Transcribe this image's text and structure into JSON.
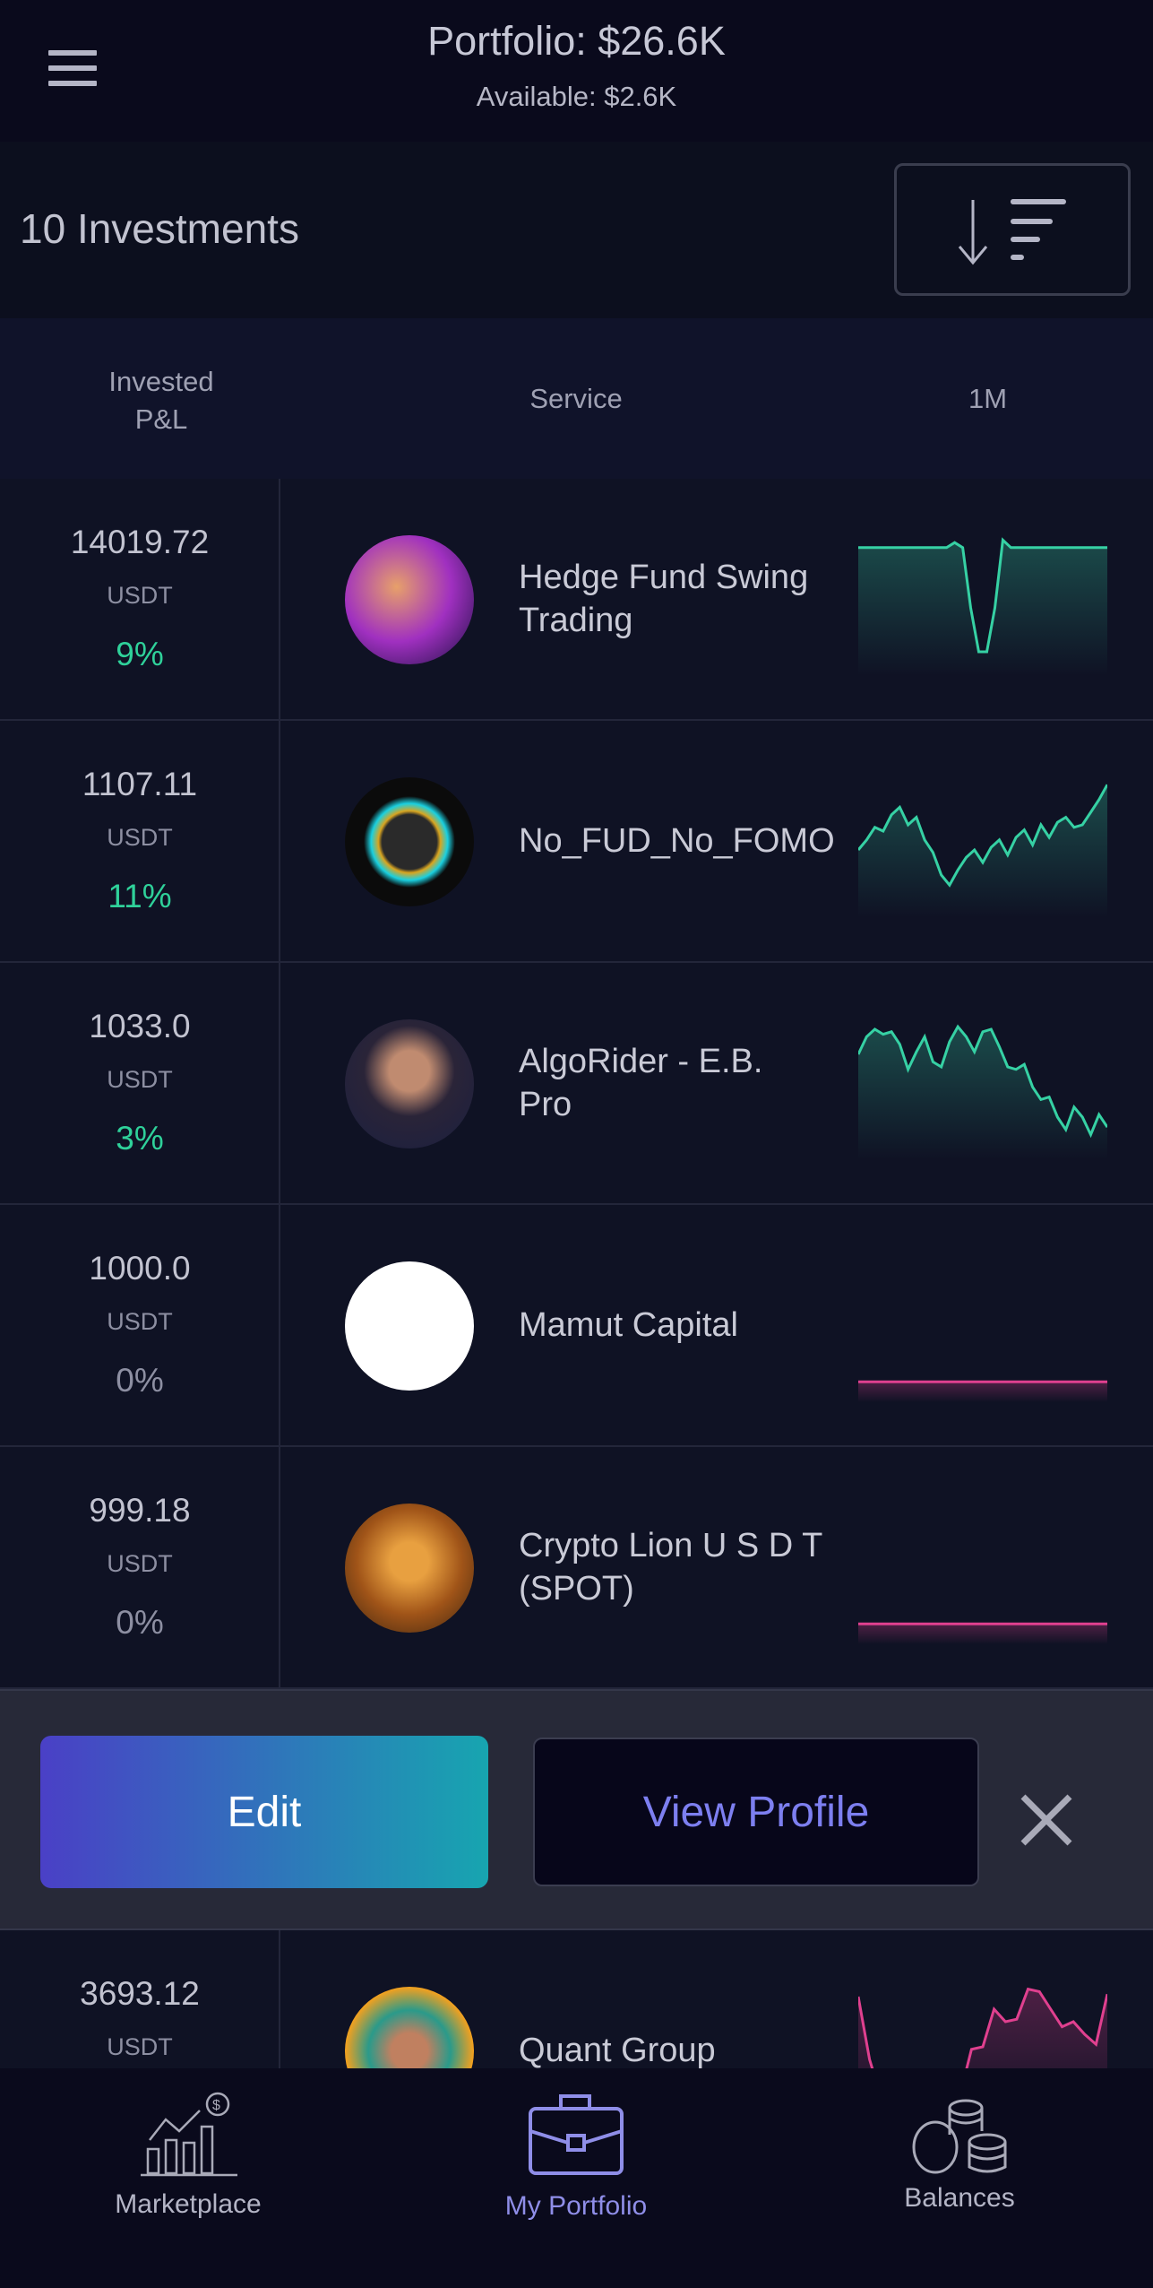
{
  "header": {
    "title": "Portfolio: $26.6K",
    "available": "Available: $2.6K",
    "menu_icon": "hamburger-menu-icon"
  },
  "toolbar": {
    "count_label": "10 Investments",
    "sort_icon": "sort-descending-icon"
  },
  "columns": {
    "invested_line1": "Invested",
    "invested_line2": "P&L",
    "service": "Service",
    "period": "1M"
  },
  "colors": {
    "positive": "#2fd19a",
    "neutral": "#8d8fa2",
    "spark_up": "#36d1a4",
    "spark_flat": "#e0408f",
    "accent": "#7d7ff0"
  },
  "rows": [
    {
      "amount": "14019.72",
      "unit": "USDT",
      "pnl": "9%",
      "pnl_color": "#2fd19a",
      "name": "Hedge Fund Swing Trading",
      "spark": [
        88,
        88,
        88,
        88,
        88,
        88,
        88,
        88,
        88,
        88,
        88,
        88,
        92,
        88,
        40,
        5,
        5,
        40,
        94,
        88,
        88,
        88,
        88,
        88,
        88,
        88,
        88,
        88,
        88,
        88,
        88,
        88
      ],
      "spark_color": "#36d1a4"
    },
    {
      "amount": "1107.11",
      "unit": "USDT",
      "pnl": "11%",
      "pnl_color": "#2fd19a",
      "name": "No_FUD_No_FOMO",
      "spark": [
        40,
        48,
        58,
        55,
        68,
        74,
        60,
        66,
        48,
        38,
        20,
        12,
        24,
        34,
        40,
        30,
        42,
        48,
        36,
        50,
        56,
        44,
        60,
        50,
        62,
        66,
        58,
        60,
        70,
        80,
        92
      ],
      "spark_color": "#36d1a4"
    },
    {
      "amount": "1033.0",
      "unit": "USDT",
      "pnl": "3%",
      "pnl_color": "#2fd19a",
      "name": "AlgoRider - E.B. Pro",
      "spark": [
        70,
        84,
        90,
        86,
        88,
        78,
        58,
        72,
        84,
        64,
        60,
        80,
        92,
        84,
        72,
        88,
        90,
        76,
        60,
        58,
        62,
        44,
        34,
        36,
        20,
        10,
        28,
        20,
        6,
        22,
        12
      ],
      "spark_color": "#36d1a4"
    },
    {
      "amount": "1000.0",
      "unit": "USDT",
      "pnl": "0%",
      "pnl_color": "#8d8fa2",
      "name": "Mamut Capital",
      "spark": [
        2,
        2
      ],
      "spark_color": "#e0408f"
    },
    {
      "amount": "999.18",
      "unit": "USDT",
      "pnl": "0%",
      "pnl_color": "#8d8fa2",
      "name": "Crypto Lion U S D T (SPOT)",
      "spark": [
        2,
        2
      ],
      "spark_color": "#e0408f"
    },
    {
      "amount": "3693.12",
      "unit": "USDT",
      "pnl": "",
      "pnl_color": "#2fd19a",
      "name": "Quant Group",
      "spark": [
        90,
        40,
        10,
        16,
        14,
        8,
        10,
        18,
        14,
        12,
        48,
        50,
        80,
        70,
        72,
        96,
        94,
        80,
        66,
        70,
        60,
        52,
        92
      ],
      "spark_color": "#e0408f"
    }
  ],
  "action_sheet": {
    "edit_label": "Edit",
    "view_profile_label": "View Profile",
    "close_icon": "close-x-icon"
  },
  "nav": {
    "items": [
      {
        "label": "Marketplace",
        "icon": "chart-growth-dollar-icon",
        "active": false
      },
      {
        "label": "My Portfolio",
        "icon": "briefcase-icon",
        "active": true
      },
      {
        "label": "Balances",
        "icon": "coins-stack-icon",
        "active": false
      }
    ]
  }
}
